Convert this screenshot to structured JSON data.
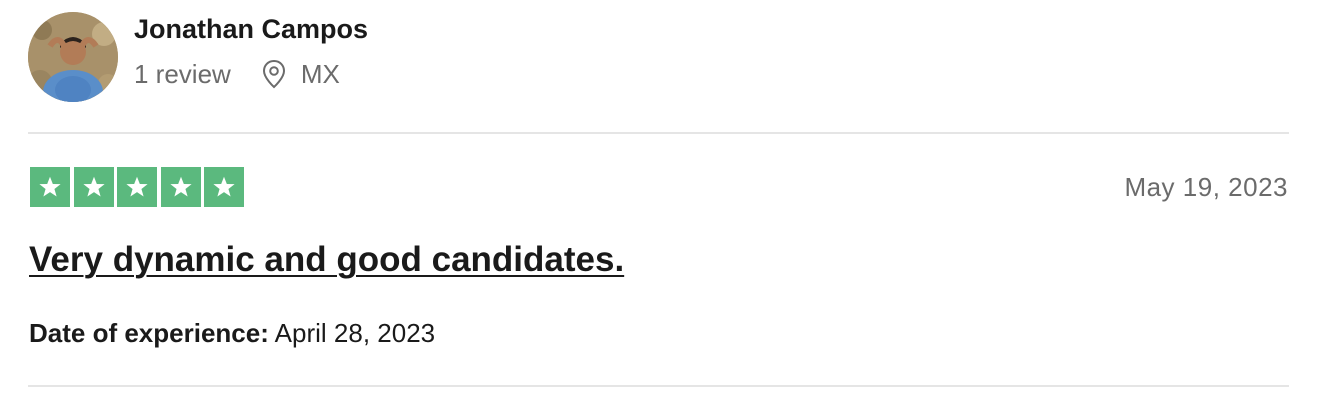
{
  "reviewer": {
    "name": "Jonathan Campos",
    "review_count": "1 review",
    "location": "MX",
    "avatar_icon": "reviewer-avatar-photo"
  },
  "review": {
    "rating": 5,
    "max_rating": 5,
    "date": "May 19, 2023",
    "title": "Very dynamic and good candidates.",
    "experience_label": "Date of experience:",
    "experience_date": "April 28, 2023"
  },
  "colors": {
    "star_green": "#5bb97e",
    "text_dark": "#1a1a1a",
    "text_muted": "#6b6b6b",
    "divider": "#e5e5e5"
  },
  "icons": {
    "location": "map-pin-icon",
    "star": "star-icon"
  }
}
